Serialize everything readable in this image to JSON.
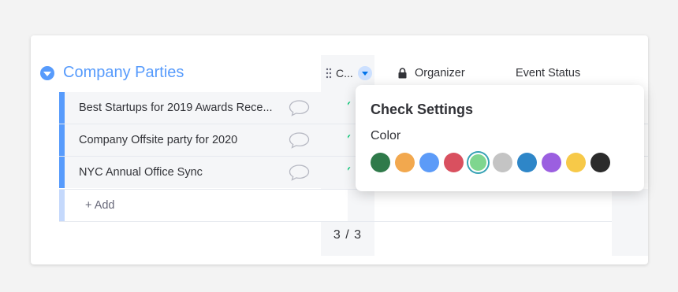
{
  "group": {
    "title": "Company Parties",
    "color": "#579bfc"
  },
  "rows": [
    {
      "name": "Best Startups for 2019 Awards Rece...",
      "checked": true
    },
    {
      "name": "Company Offsite party for 2020",
      "checked": true
    },
    {
      "name": "NYC Annual Office Sync",
      "checked": true
    }
  ],
  "add_row": {
    "label": "+ Add"
  },
  "columns": {
    "check": {
      "title": "C...",
      "summary": "3 / 3",
      "check_glyph": "✓"
    },
    "organizer": {
      "title": "Organizer",
      "icon": "lock-icon"
    },
    "event_status": {
      "title": "Event Status"
    }
  },
  "popup": {
    "title": "Check Settings",
    "color_label": "Color",
    "colors": [
      "#2f7a4a",
      "#f2a84e",
      "#5c9bf8",
      "#d9505f",
      "#7fd68f",
      "#c4c4c4",
      "#2e86c8",
      "#9b5fe0",
      "#f7c948",
      "#2b2b2b"
    ],
    "selected_index": 4
  }
}
